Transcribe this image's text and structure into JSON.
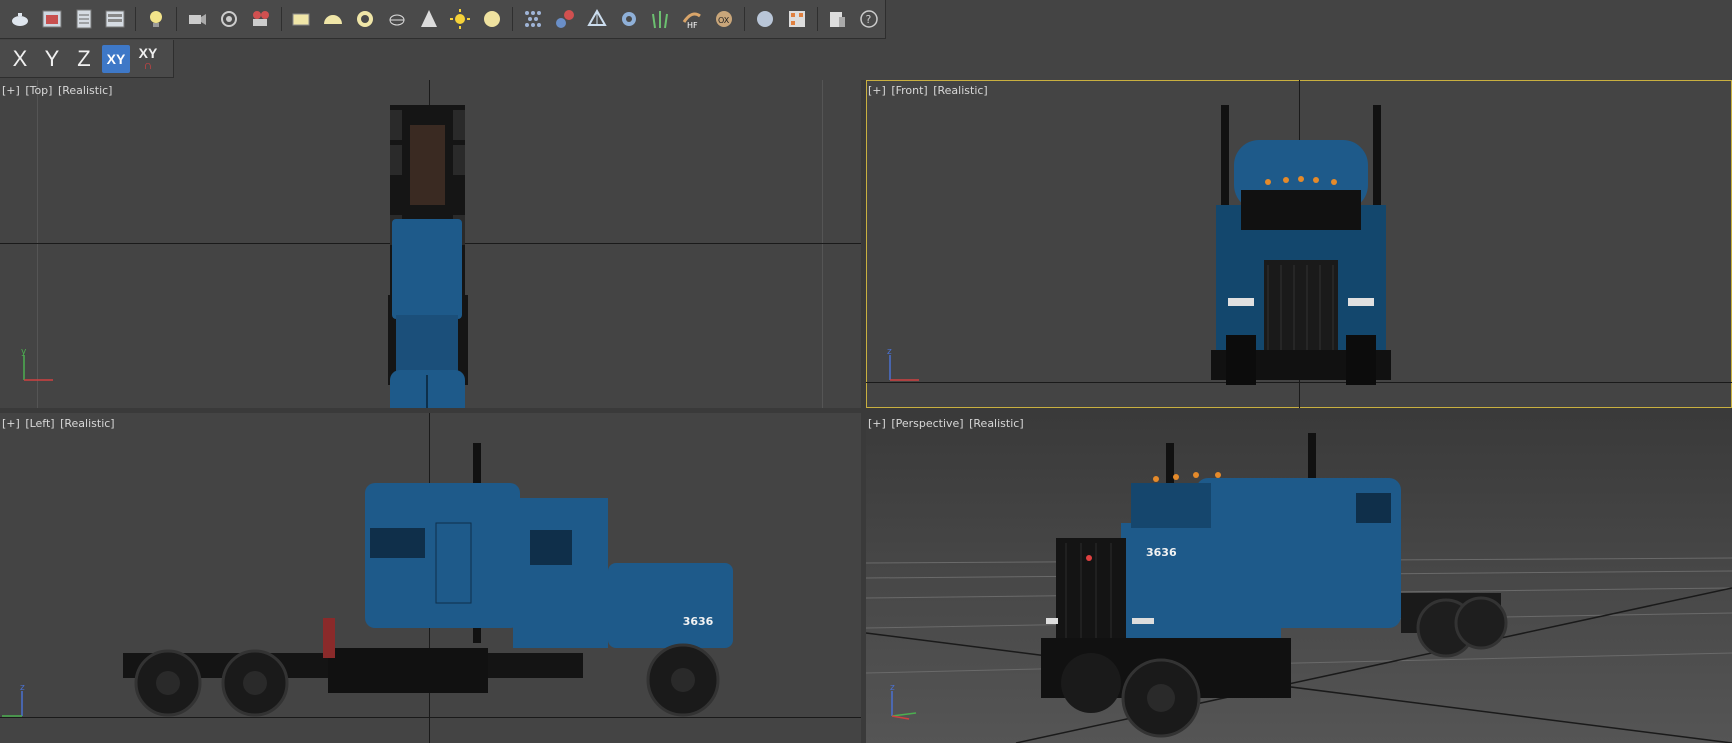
{
  "toolbar": {
    "icons": [
      "teapot-icon",
      "render-frame-icon",
      "render-setup-icon",
      "render-settings-icon",
      "light-icon",
      "camera-icon",
      "sound-icon",
      "video-camera-icon",
      "plane-icon",
      "hemisphere-icon",
      "torus-icon",
      "teapot-mesh-icon",
      "cone-icon",
      "sun-icon",
      "sphere-icon",
      "particle-icon",
      "dynamics-icon",
      "space-warp-icon",
      "gear-icon",
      "grass-icon",
      "hf-icon",
      "scatter-icon",
      "material-ball-icon",
      "material-editor-icon",
      "clipboard-icon",
      "help-icon"
    ]
  },
  "axis_toolbar": {
    "x": "X",
    "y": "Y",
    "z": "Z",
    "xy": "XY",
    "xy_snap": "XY"
  },
  "viewports": {
    "top": {
      "plus": "[+]",
      "view": "[Top]",
      "shading": "[Realistic]",
      "axis_y": "y"
    },
    "front": {
      "plus": "[+]",
      "view": "[Front]",
      "shading": "[Realistic]",
      "axis_z": "z"
    },
    "left": {
      "plus": "[+]",
      "view": "[Left]",
      "shading": "[Realistic]",
      "axis_z": "z"
    },
    "perspective": {
      "plus": "[+]",
      "view": "[Perspective]",
      "shading": "[Realistic]",
      "axis_z": "z"
    }
  },
  "truck": {
    "number": "3636",
    "cab_color": "#1e5a8a",
    "chassis_color": "#141414"
  },
  "colors": {
    "active_viewport_border": "#c9b040",
    "selected_axis": "#3e78c7"
  }
}
